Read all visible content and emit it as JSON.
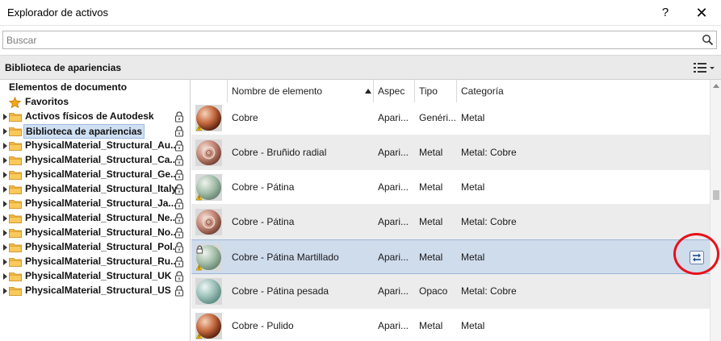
{
  "window": {
    "title": "Explorador de activos",
    "help_label": "?",
    "close_label": "✕"
  },
  "search": {
    "placeholder": "Buscar",
    "value": ""
  },
  "library_bar": {
    "title": "Biblioteca de apariencias"
  },
  "tree": {
    "document_elements": "Elementos de documento",
    "favorites": "Favoritos",
    "items": [
      {
        "label": "Activos físicos de Autodesk",
        "locked": true,
        "selected": false
      },
      {
        "label": "Biblioteca de apariencias",
        "locked": true,
        "selected": true
      },
      {
        "label": "PhysicalMaterial_Structural_Au...",
        "locked": true,
        "selected": false
      },
      {
        "label": "PhysicalMaterial_Structural_Ca...",
        "locked": true,
        "selected": false
      },
      {
        "label": "PhysicalMaterial_Structural_Ge...",
        "locked": true,
        "selected": false
      },
      {
        "label": "PhysicalMaterial_Structural_Italy",
        "locked": true,
        "selected": false
      },
      {
        "label": "PhysicalMaterial_Structural_Ja...",
        "locked": true,
        "selected": false
      },
      {
        "label": "PhysicalMaterial_Structural_Ne...",
        "locked": true,
        "selected": false
      },
      {
        "label": "PhysicalMaterial_Structural_No...",
        "locked": true,
        "selected": false
      },
      {
        "label": "PhysicalMaterial_Structural_Pol...",
        "locked": true,
        "selected": false
      },
      {
        "label": "PhysicalMaterial_Structural_Ru...",
        "locked": true,
        "selected": false
      },
      {
        "label": "PhysicalMaterial_Structural_UK",
        "locked": true,
        "selected": false
      },
      {
        "label": "PhysicalMaterial_Structural_US",
        "locked": true,
        "selected": false
      }
    ]
  },
  "grid": {
    "columns": {
      "name": "Nombre de elemento",
      "aspect": "Aspec",
      "type": "Tipo",
      "category": "Categoría"
    },
    "rows": [
      {
        "name": "Cobre",
        "aspect": "Apari...",
        "type": "Genéri...",
        "category": "Metal",
        "swatch": "copper-polished",
        "warning": true,
        "locked": false
      },
      {
        "name": "Cobre - Bruñido radial",
        "aspect": "Apari...",
        "type": "Metal",
        "category": "Metal: Cobre",
        "swatch": "copper-radial",
        "warning": false,
        "locked": false
      },
      {
        "name": "Cobre - Pátina",
        "aspect": "Apari...",
        "type": "Metal",
        "category": "Metal",
        "swatch": "patina-green",
        "warning": true,
        "locked": false
      },
      {
        "name": "Cobre - Pátina",
        "aspect": "Apari...",
        "type": "Metal",
        "category": "Metal: Cobre",
        "swatch": "copper-radial",
        "warning": false,
        "locked": false
      },
      {
        "name": "Cobre - Pátina Martillado",
        "aspect": "Apari...",
        "type": "Metal",
        "category": "Metal",
        "swatch": "patina-green",
        "warning": true,
        "locked": true
      },
      {
        "name": "Cobre - Pátina pesada",
        "aspect": "Apari...",
        "type": "Opaco",
        "category": "Metal: Cobre",
        "swatch": "patina-teal",
        "warning": false,
        "locked": false
      },
      {
        "name": "Cobre - Pulido",
        "aspect": "Apari...",
        "type": "Metal",
        "category": "Metal",
        "swatch": "copper-polished",
        "warning": true,
        "locked": false
      }
    ]
  },
  "colors": {
    "selection": "#cfdcec",
    "annotation": "#e8101a",
    "folder": "#f4b942"
  }
}
